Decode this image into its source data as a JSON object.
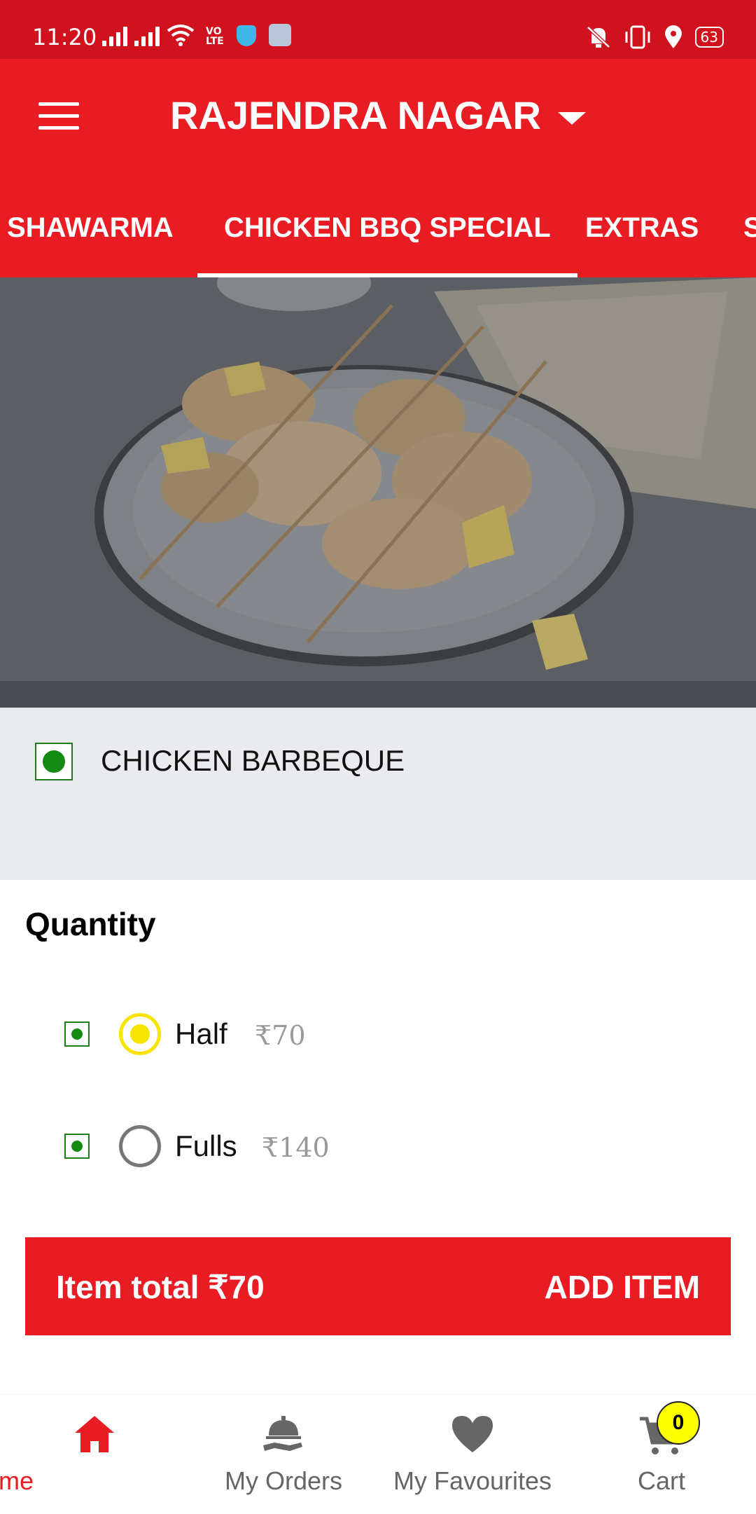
{
  "status_bar": {
    "time": "11:20",
    "battery": "63"
  },
  "header": {
    "location": "RAJENDRA NAGAR"
  },
  "tabs": [
    {
      "label": "SHAWARMA"
    },
    {
      "label": "CHICKEN BBQ SPECIAL"
    },
    {
      "label": "EXTRAS"
    },
    {
      "label": "S"
    }
  ],
  "item": {
    "name": "CHICKEN BARBEQUE"
  },
  "quantity": {
    "title": "Quantity",
    "options": [
      {
        "label": "Half",
        "price": "₹70",
        "selected": true
      },
      {
        "label": "Fulls",
        "price": "₹140",
        "selected": false
      }
    ]
  },
  "add_bar": {
    "total": "Item total ₹70",
    "button": "ADD ITEM"
  },
  "bottom_nav": [
    {
      "label": "Home",
      "icon": "home-icon"
    },
    {
      "label": "My Orders",
      "icon": "orders-icon"
    },
    {
      "label": "My Favourites",
      "icon": "heart-icon"
    },
    {
      "label": "Cart",
      "icon": "cart-icon"
    }
  ],
  "cart_count": "0",
  "colors": {
    "brand_red": "#e91b23",
    "status_red": "#d0121f",
    "veg_green": "#138b13",
    "radio_yellow": "#f7e500"
  }
}
